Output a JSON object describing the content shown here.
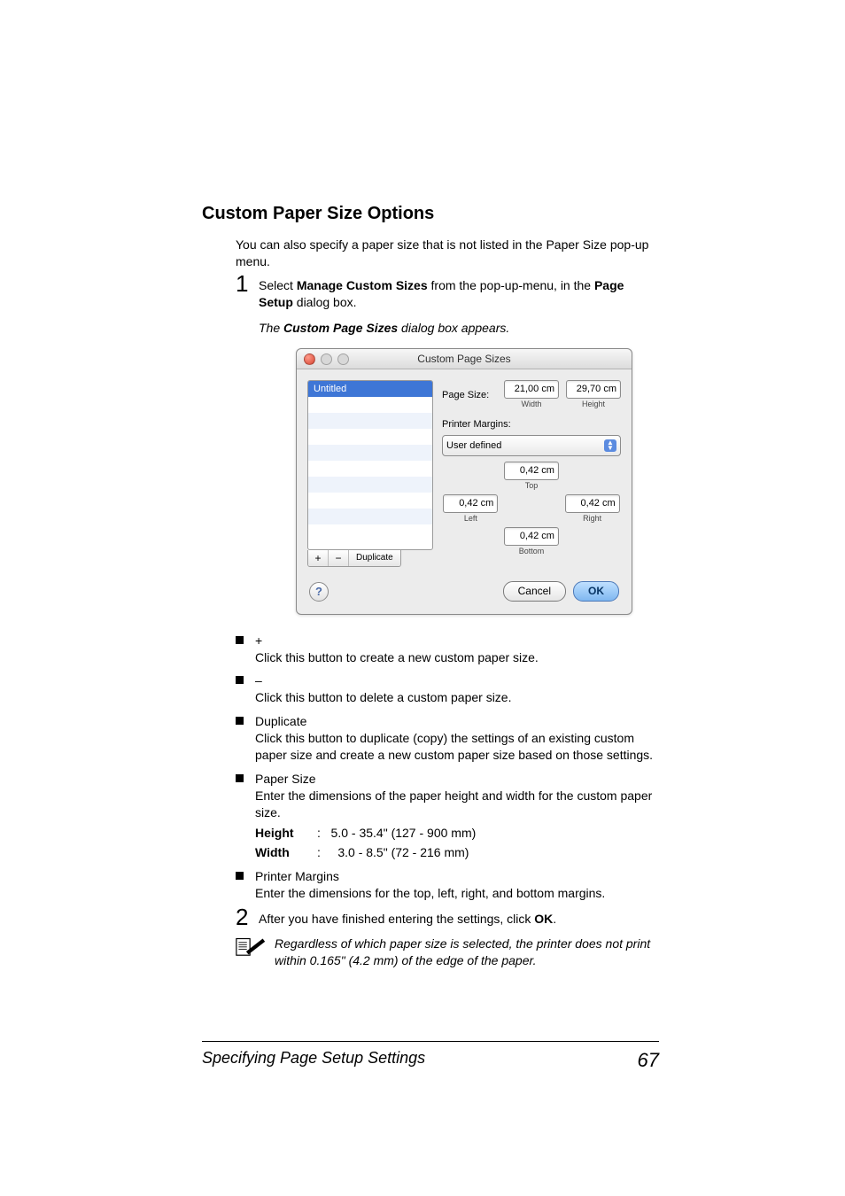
{
  "heading": "Custom Paper Size Options",
  "intro": "You can also specify a paper size that is not listed in the Paper Size pop-up menu.",
  "step1": {
    "num": "1",
    "pre": "Select ",
    "bold": "Manage Custom Sizes",
    "mid": " from the pop-up-menu, in the ",
    "bold2": "Page Setup",
    "post": " dialog box."
  },
  "caption_pre": "The ",
  "caption_bold": "Custom Page Sizes",
  "caption_post": " dialog box appears.",
  "dialog": {
    "title": "Custom Page Sizes",
    "list_item": "Untitled",
    "btn_plus": "+",
    "btn_minus": "−",
    "btn_dup": "Duplicate",
    "page_size_label": "Page Size:",
    "width_val": "21,00 cm",
    "width_lab": "Width",
    "height_val": "29,70 cm",
    "height_lab": "Height",
    "margins_label": "Printer Margins:",
    "select_val": "User defined",
    "m_top": "0,42 cm",
    "m_top_lab": "Top",
    "m_left": "0,42 cm",
    "m_left_lab": "Left",
    "m_right": "0,42 cm",
    "m_right_lab": "Right",
    "m_bottom": "0,42 cm",
    "m_bottom_lab": "Bottom",
    "help": "?",
    "cancel": "Cancel",
    "ok": "OK"
  },
  "bullets": {
    "plus_t": "+",
    "plus_d": "Click this button to create a new custom paper size.",
    "minus_t": "–",
    "minus_d": "Click this button to delete a custom paper size.",
    "dup_t": "Duplicate",
    "dup_d": "Click this button to duplicate (copy) the settings of an existing custom paper size and create a new custom paper size based on those settings.",
    "ps_t": "Paper Size",
    "ps_d": "Enter the dimensions of the paper height and width for the custom paper size.",
    "h_lab": "Height",
    "h_val": ":   5.0 - 35.4\" (127 - 900 mm)",
    "w_lab": "Width",
    "w_val": ":     3.0 - 8.5\" (72 - 216 mm)",
    "pm_t": "Printer Margins",
    "pm_d": "Enter the dimensions for the top, left, right, and bottom margins."
  },
  "step2": {
    "num": "2",
    "pre": "After you have finished entering the settings, click ",
    "bold": "OK",
    "post": "."
  },
  "note": "Regardless of which paper size is selected, the printer does not print within 0.165\" (4.2 mm) of the edge of the paper.",
  "footer_left": "Specifying Page Setup Settings",
  "footer_right": "67"
}
